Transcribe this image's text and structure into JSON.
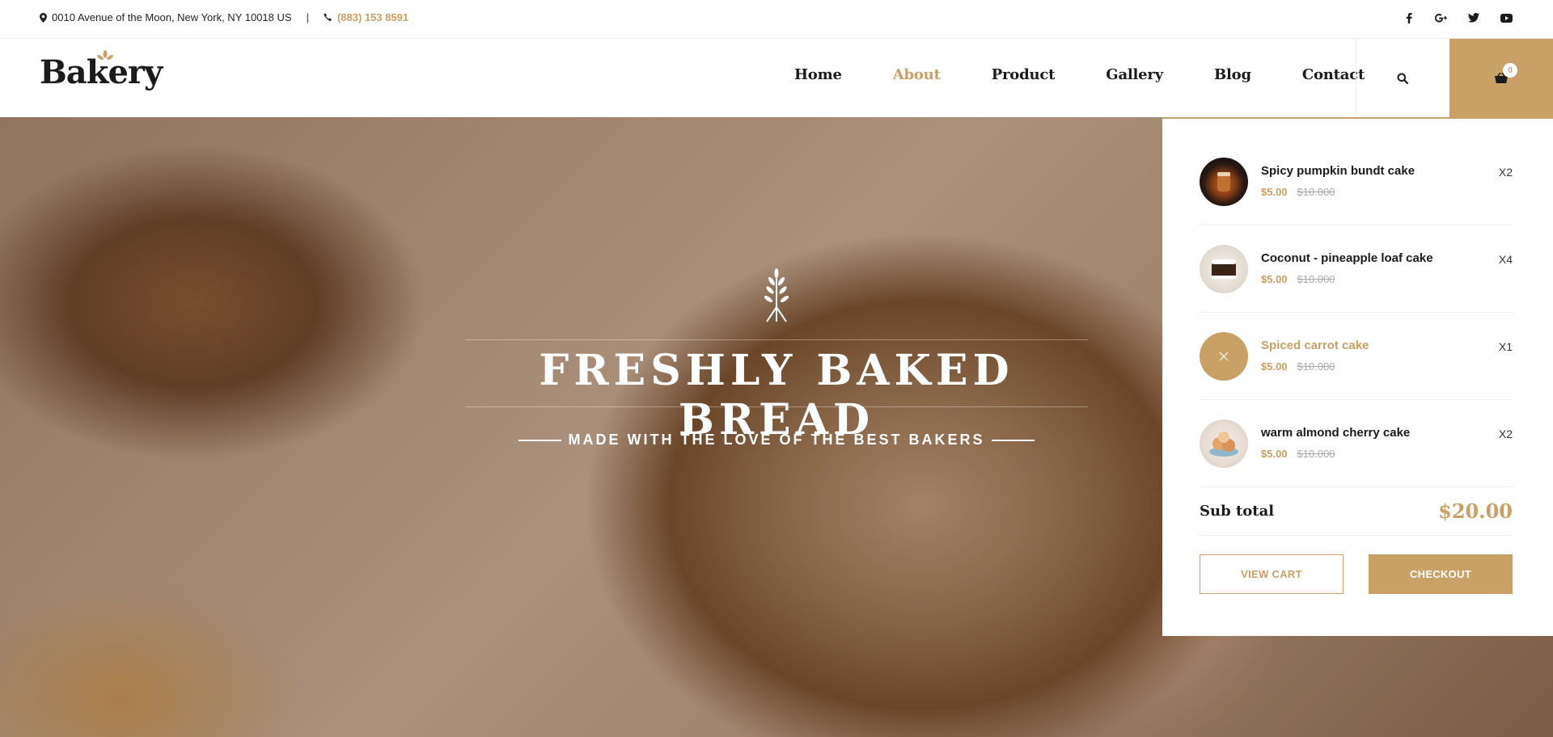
{
  "topbar": {
    "address": "0010 Avenue of the Moon, New York, NY 10018 US",
    "separator": "|",
    "phone": "(883) 153 8591",
    "social": [
      "facebook-icon",
      "google-plus-icon",
      "twitter-icon",
      "youtube-icon"
    ]
  },
  "header": {
    "logo": "Bakery",
    "nav": [
      {
        "label": "Home",
        "active": false
      },
      {
        "label": "About",
        "active": true
      },
      {
        "label": "Product",
        "active": false
      },
      {
        "label": "Gallery",
        "active": false
      },
      {
        "label": "Blog",
        "active": false
      },
      {
        "label": "Contact",
        "active": false
      }
    ],
    "cart_count": "0"
  },
  "hero": {
    "title": "FRESHLY BAKED BREAD",
    "subtitle": "MADE WITH THE LOVE OF THE BEST BAKERS"
  },
  "cart": {
    "items": [
      {
        "name": "Spicy pumpkin bundt cake",
        "price": "$5.00",
        "old_price": "$10.000",
        "qty": "X2"
      },
      {
        "name": "Coconut - pineapple loaf cake",
        "price": "$5.00",
        "old_price": "$10.000",
        "qty": "X4"
      },
      {
        "name": "Spiced carrot cake",
        "price": "$5.00",
        "old_price": "$10.000",
        "qty": "X1"
      },
      {
        "name": "warm almond cherry cake",
        "price": "$5.00",
        "old_price": "$10.000",
        "qty": "X2"
      }
    ],
    "subtotal_label": "Sub total",
    "subtotal_value": "$20.00",
    "view_cart": "VIEW CART",
    "checkout": "CHECKOUT"
  },
  "colors": {
    "accent": "#c9a066",
    "text": "#1b1b1b"
  }
}
